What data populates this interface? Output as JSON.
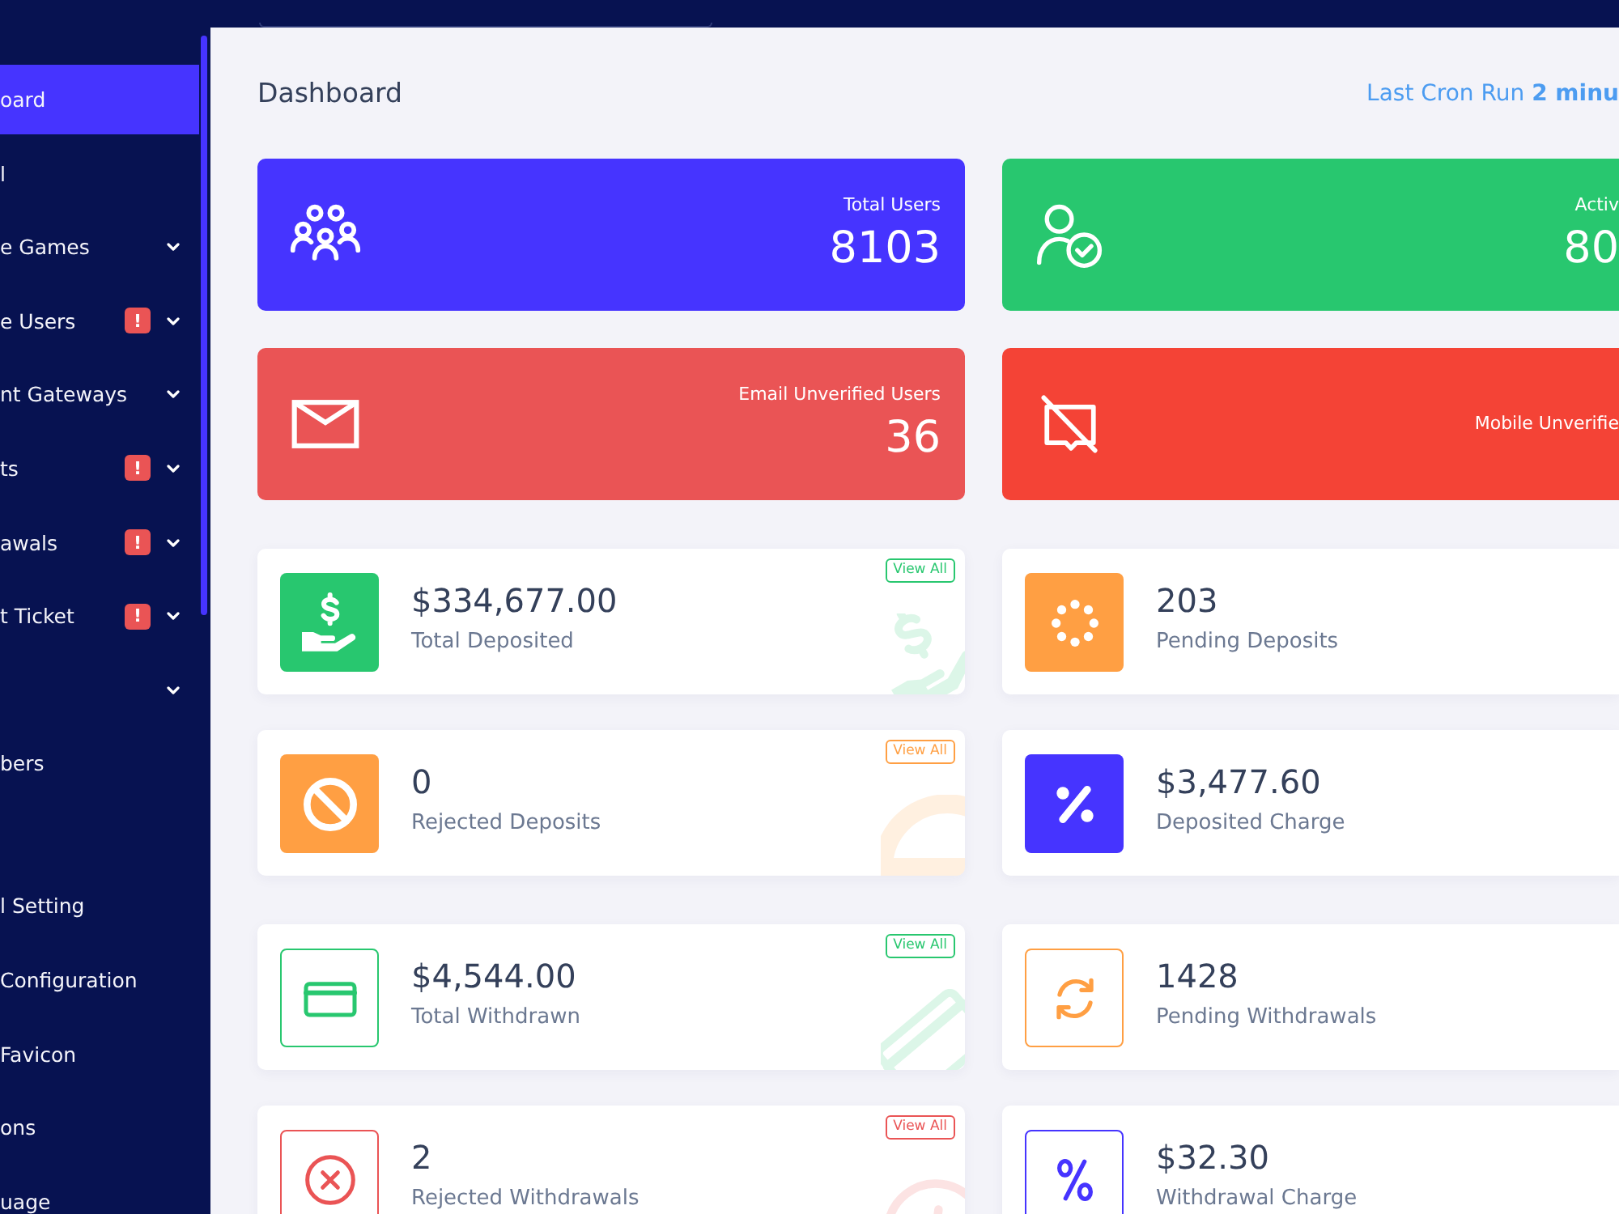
{
  "header": {
    "search_field": true
  },
  "sidebar": {
    "groups": [
      {
        "items": [
          {
            "label": "oard",
            "selected": true,
            "submenu": false
          },
          {
            "label": "l",
            "selected": false,
            "submenu": false
          },
          {
            "label": "e Games",
            "selected": false,
            "submenu": true
          },
          {
            "label": "e Users",
            "selected": false,
            "submenu": true,
            "badge": "!"
          },
          {
            "label": "nt Gateways",
            "selected": false,
            "submenu": true
          },
          {
            "label": "ts",
            "selected": false,
            "submenu": true,
            "badge": "!"
          },
          {
            "label": "awals",
            "selected": false,
            "submenu": true,
            "badge": "!"
          },
          {
            "label": "t Ticket",
            "selected": false,
            "submenu": true,
            "badge": "!"
          },
          {
            "selected": false,
            "submenu": true
          },
          {
            "label": "bers",
            "selected": false,
            "submenu": false
          }
        ]
      },
      {
        "items": [
          {
            "label": "l Setting",
            "selected": false,
            "submenu": false
          },
          {
            "label": "Configuration",
            "selected": false,
            "submenu": false
          },
          {
            "label": "Favicon",
            "selected": false,
            "submenu": false
          },
          {
            "label": "ons",
            "selected": false,
            "submenu": false
          },
          {
            "label": "uage",
            "selected": false,
            "submenu": false
          }
        ]
      }
    ]
  },
  "page": {
    "title": "Dashboard",
    "cron_status": "Last Cron Run **2 minu**"
  },
  "stat_cards": [
    {
      "label": "Total Users",
      "value": "8103",
      "color": "#4634ff"
    },
    {
      "label": "Activ",
      "value": "80",
      "color": "#28c76f"
    },
    {
      "label": "Email Unverified Users",
      "value": "36",
      "color": "#ea5455"
    },
    {
      "label": "Mobile Unverifie",
      "color": "#f44336"
    }
  ],
  "widget_sections": [
    {
      "widgets": [
        {
          "kind": "filled",
          "color": "#28c76f",
          "value": "$334,677.00",
          "label": "Total Deposited",
          "view_all": "View All"
        },
        {
          "kind": "filled",
          "color": "#ff9f43",
          "value": "203",
          "label": "Pending Deposits"
        },
        {
          "kind": "filled",
          "color": "#ff9f43",
          "value": "0",
          "label": "Rejected Deposits",
          "view_all": "View All"
        },
        {
          "kind": "filled",
          "color": "#4634ff",
          "value": "$3,477.60",
          "label": "Deposited Charge"
        }
      ]
    },
    {
      "widgets": [
        {
          "kind": "outline",
          "color": "#28c76f",
          "value": "$4,544.00",
          "label": "Total Withdrawn",
          "view_all": "View All"
        },
        {
          "kind": "outline",
          "color": "#ff9f43",
          "value": "1428",
          "label": "Pending Withdrawals"
        },
        {
          "kind": "outline",
          "color": "#ea5455",
          "value": "2",
          "label": "Rejected Withdrawals",
          "view_all": "View All"
        },
        {
          "kind": "outline",
          "color": "#4634ff",
          "value": "$32.30",
          "label": "Withdrawal Charge"
        }
      ]
    }
  ]
}
